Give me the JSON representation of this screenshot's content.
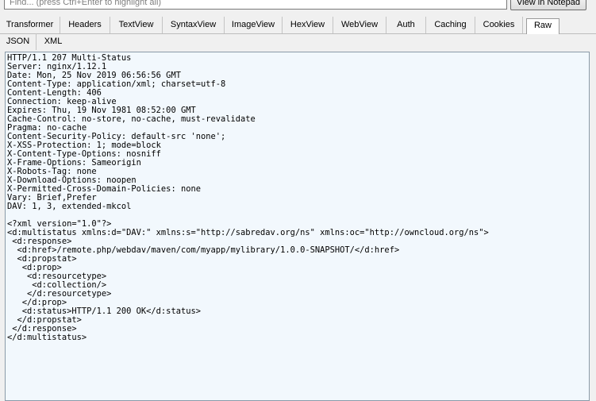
{
  "toolbar": {
    "find_placeholder": "Find... (press Ctrl+Enter to highlight all)",
    "view_in_notepad": "View in Notepad"
  },
  "tabs_row1": [
    {
      "label": "Transformer",
      "selected": false
    },
    {
      "label": "Headers",
      "selected": false
    },
    {
      "label": "TextView",
      "selected": false
    },
    {
      "label": "SyntaxView",
      "selected": false
    },
    {
      "label": "ImageView",
      "selected": false
    },
    {
      "label": "HexView",
      "selected": false
    },
    {
      "label": "WebView",
      "selected": false
    },
    {
      "label": "Auth",
      "selected": false
    },
    {
      "label": "Caching",
      "selected": false
    },
    {
      "label": "Cookies",
      "selected": false
    },
    {
      "label": "Raw",
      "selected": true
    }
  ],
  "tabs_row2": [
    {
      "label": "JSON",
      "selected": false
    },
    {
      "label": "XML",
      "selected": false
    }
  ],
  "raw_lines": [
    "HTTP/1.1 207 Multi-Status",
    "Server: nginx/1.12.1",
    "Date: Mon, 25 Nov 2019 06:56:56 GMT",
    "Content-Type: application/xml; charset=utf-8",
    "Content-Length: 406",
    "Connection: keep-alive",
    "Expires: Thu, 19 Nov 1981 08:52:00 GMT",
    "Cache-Control: no-store, no-cache, must-revalidate",
    "Pragma: no-cache",
    "Content-Security-Policy: default-src 'none';",
    "X-XSS-Protection: 1; mode=block",
    "X-Content-Type-Options: nosniff",
    "X-Frame-Options: Sameorigin",
    "X-Robots-Tag: none",
    "X-Download-Options: noopen",
    "X-Permitted-Cross-Domain-Policies: none",
    "Vary: Brief,Prefer",
    "DAV: 1, 3, extended-mkcol",
    "",
    "<?xml version=\"1.0\"?>",
    "<d:multistatus xmlns:d=\"DAV:\" xmlns:s=\"http://sabredav.org/ns\" xmlns:oc=\"http://owncloud.org/ns\">",
    " <d:response>",
    "  <d:href>/remote.php/webdav/maven/com/myapp/mylibrary/1.0.0-SNAPSHOT/</d:href>",
    "  <d:propstat>",
    "   <d:prop>",
    "    <d:resourcetype>",
    "     <d:collection/>",
    "    </d:resourcetype>",
    "   </d:prop>",
    "   <d:status>HTTP/1.1 200 OK</d:status>",
    "  </d:propstat>",
    " </d:response>",
    "</d:multistatus>"
  ]
}
